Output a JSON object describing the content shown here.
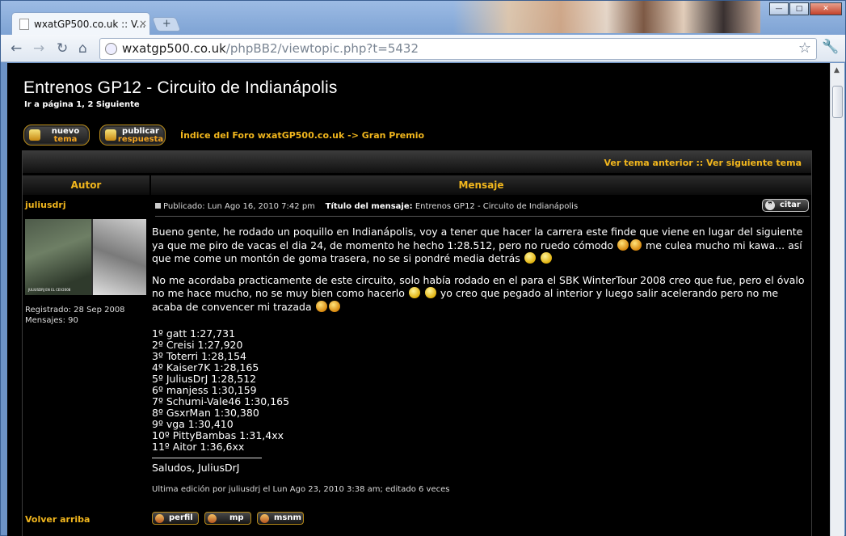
{
  "browser": {
    "tab_title": "wxatGP500.co.uk :: V...",
    "tab_close": "×",
    "new_tab": "+",
    "url_host": "wxatgp500.co.uk",
    "url_path": "/phpBB2/viewtopic.php?t=5432",
    "back": "←",
    "forward": "→",
    "reload": "↻",
    "home": "⌂",
    "star": "☆",
    "wrench": "🔧",
    "min": "—",
    "max": "□",
    "close": "✕"
  },
  "page": {
    "title": "Entrenos GP12 - Circuito de Indianápolis",
    "pagination": "Ir a página 1, 2  Siguiente",
    "new_topic": {
      "line1": "nuevo",
      "line2": "tema"
    },
    "reply": {
      "line1": "publicar",
      "line2": "respuesta"
    },
    "forum_path": "Índice del Foro wxatGP500.co.uk -> Gran Premio",
    "topic_nav": "Ver tema anterior :: Ver siguiente tema",
    "col_author": "Autor",
    "col_message": "Mensaje"
  },
  "post": {
    "author": "juliusdrj",
    "avatar_caption": "JULIUSDRJ EN EL CEV2008",
    "registered": "Registrado: 28 Sep 2008",
    "messages": "Mensajes: 90",
    "published": "Publicado: Lun Ago 16, 2010 7:42 pm",
    "subject_label": "Título del mensaje:",
    "subject": "Entrenos GP12 - Circuito de Indianápolis",
    "quote_label": "citar",
    "para1a": "Bueno gente, he rodado un poquillo en Indianápolis, voy a tener que hacer la carrera este finde que viene en lugar del siguiente ya que me piro de vacas el dia 24, de momento he hecho 1:28.512, pero no ruedo cómodo",
    "para1b": "me culea mucho mi kawa... así que me come un montón de goma trasera, no se si pondré media detrás",
    "para2a": "No me acordaba practicamente de este circuito, solo había rodado en el para el SBK WinterTour 2008 creo que fue, pero el óvalo no me hace mucho, no se muy bien como hacerlo",
    "para2b": "yo creo que pegado al interior y luego salir acelerando pero no me acaba de convencer mi trazada",
    "times": [
      "1º gatt 1:27,731",
      "2º Creisi 1:27,920",
      "3º Toterri 1:28,154",
      "4º Kaiser7K 1:28,165",
      "5º JuliusDrJ 1:28,512",
      "6º manjess 1:30,159",
      "7º Schumi-Vale46 1:30,165",
      "8º GsxrMan 1:30,380",
      "9º vga 1:30,410",
      "10º PittyBambas 1:31,4xx",
      "11º Aitor 1:36,6xx"
    ],
    "signature": "Saludos, JuliusDrJ",
    "edit_note": "Ultima edición por juliusdrj el Lun Ago 23, 2010 3:38 am; editado 6 veces",
    "back_to_top": "Volver arriba",
    "profile_buttons": [
      "perfil",
      "mp",
      "msnm"
    ]
  }
}
